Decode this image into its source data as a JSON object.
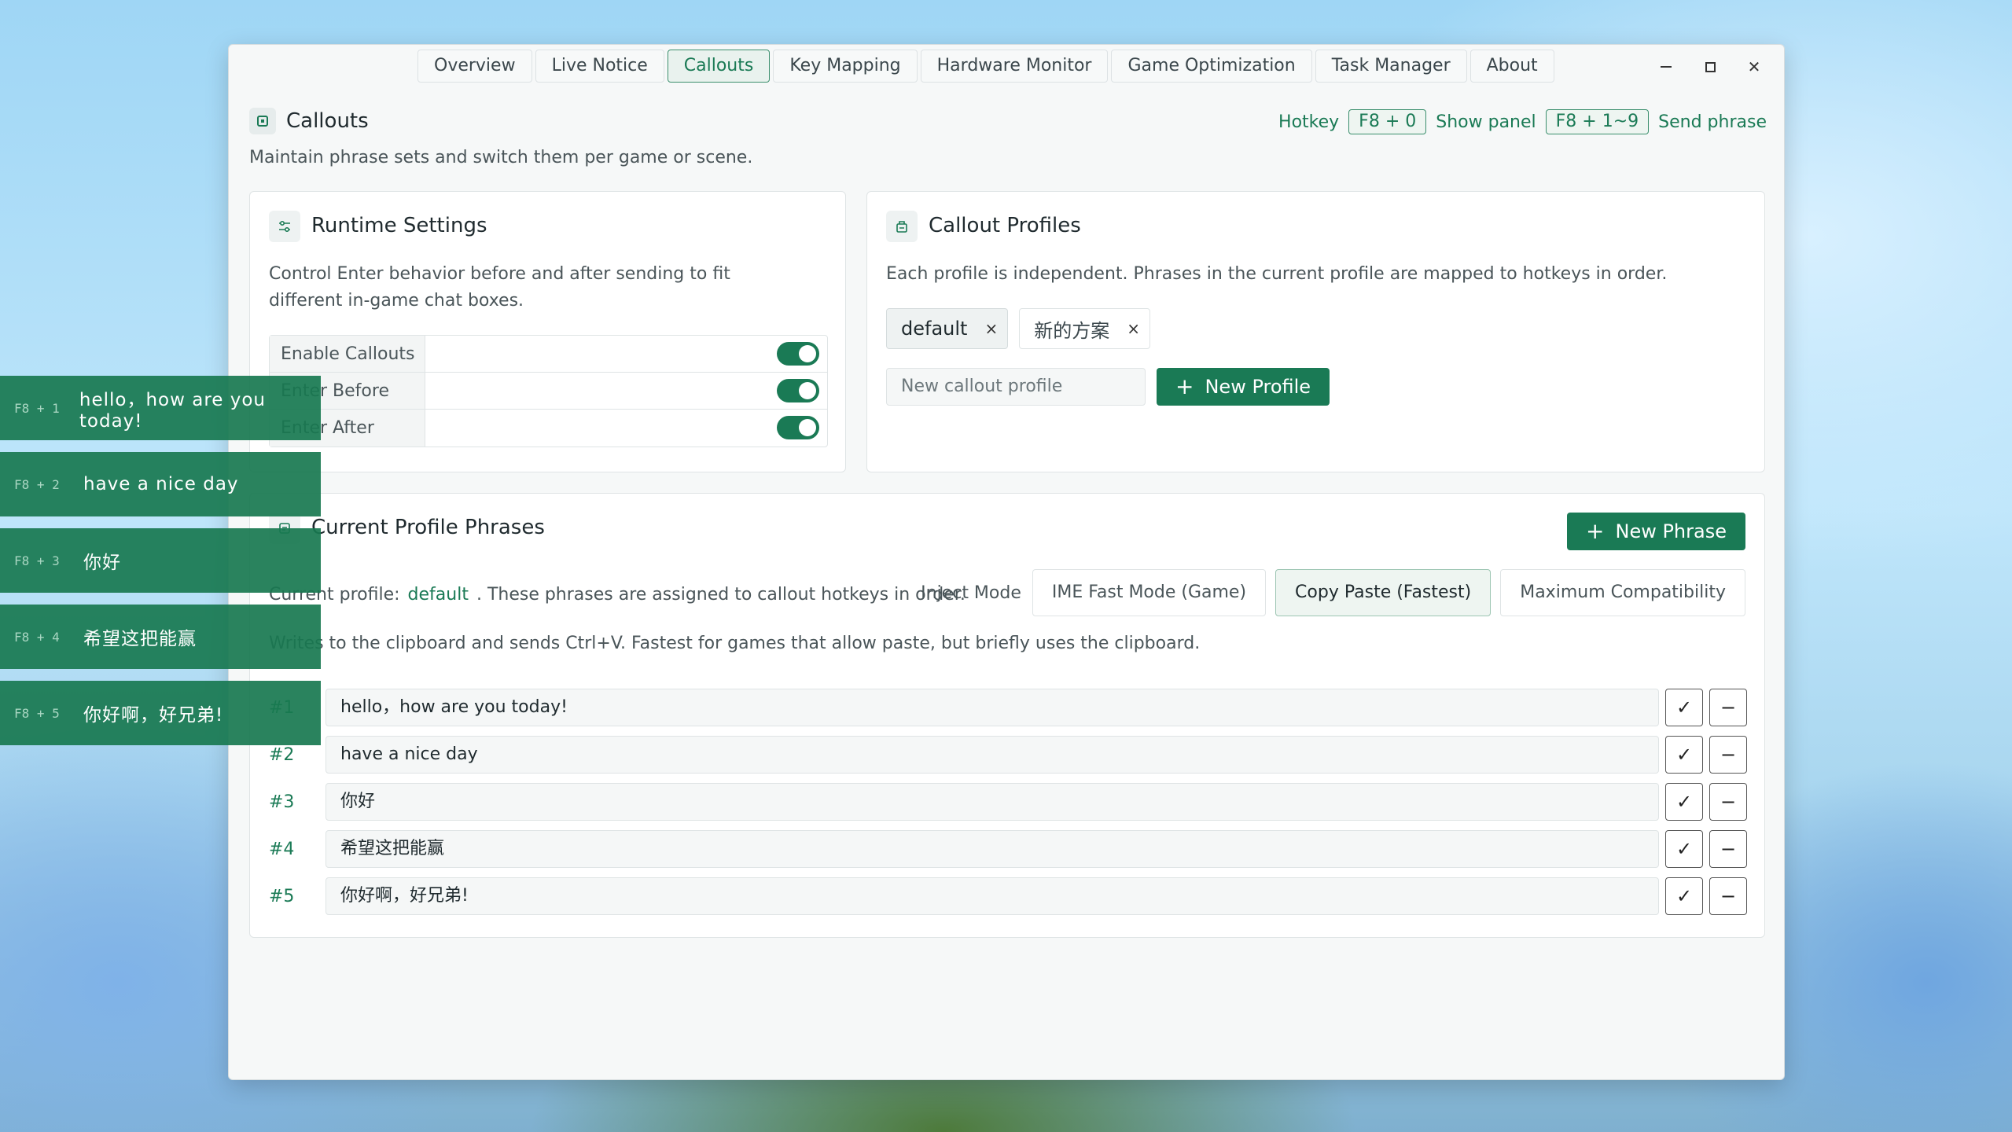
{
  "tabs": [
    {
      "label": "Overview",
      "active": false
    },
    {
      "label": "Live Notice",
      "active": false
    },
    {
      "label": "Callouts",
      "active": true
    },
    {
      "label": "Key Mapping",
      "active": false
    },
    {
      "label": "Hardware Monitor",
      "active": false
    },
    {
      "label": "Game Optimization",
      "active": false
    },
    {
      "label": "Task Manager",
      "active": false
    },
    {
      "label": "About",
      "active": false
    }
  ],
  "window_controls": {
    "close": "✕"
  },
  "header": {
    "title": "Callouts",
    "subtitle": "Maintain phrase sets and switch them per game or scene.",
    "hotkey_label": "Hotkey",
    "hotkey_show": "F8 + 0",
    "show_panel_label": "Show panel",
    "hotkey_send": "F8 + 1~9",
    "send_phrase_label": "Send phrase"
  },
  "runtime": {
    "title": "Runtime Settings",
    "description": "Control Enter behavior before and after sending to fit different in-game chat boxes.",
    "settings": [
      {
        "label": "Enable Callouts",
        "on": true
      },
      {
        "label": "Enter Before",
        "on": true
      },
      {
        "label": "Enter After",
        "on": true
      }
    ]
  },
  "profiles": {
    "title": "Callout Profiles",
    "description": "Each profile is independent. Phrases in the current profile are mapped to hotkeys in order.",
    "items": [
      {
        "name": "default",
        "active": true
      },
      {
        "name": "新的方案",
        "active": false
      }
    ],
    "remove_glyph": "×",
    "new_placeholder": "New callout profile",
    "new_button": "New Profile"
  },
  "phrases": {
    "title": "Current Profile Phrases",
    "new_button": "New Phrase",
    "current_prefix": "Current profile:",
    "current_name": "default",
    "current_suffix": ". These phrases are assigned to callout hotkeys in order.",
    "inject_label": "Inject Mode",
    "modes": [
      {
        "label": "IME Fast Mode (Game)",
        "active": false
      },
      {
        "label": "Copy Paste (Fastest)",
        "active": true
      },
      {
        "label": "Maximum Compatibility",
        "active": false
      }
    ],
    "mode_description": "Writes to the clipboard and sends Ctrl+V. Fastest for games that allow paste, but briefly uses the clipboard.",
    "items": [
      {
        "index": "#1",
        "text": "hello，how are you today!"
      },
      {
        "index": "#2",
        "text": "have a nice day"
      },
      {
        "index": "#3",
        "text": "你好"
      },
      {
        "index": "#4",
        "text": "希望这把能赢"
      },
      {
        "index": "#5",
        "text": "你好啊，好兄弟!"
      }
    ],
    "confirm_glyph": "✓",
    "remove_glyph": "−"
  },
  "overlay": {
    "items": [
      {
        "key": "F8 + 1",
        "text": "hello，how are you today!"
      },
      {
        "key": "F8 + 2",
        "text": "have a nice day"
      },
      {
        "key": "F8 + 3",
        "text": "你好"
      },
      {
        "key": "F8 + 4",
        "text": "希望这把能赢"
      },
      {
        "key": "F8 + 5",
        "text": "你好啊，好兄弟!"
      }
    ]
  },
  "colors": {
    "accent": "#1a7a55",
    "overlay_bg": "#18784f"
  },
  "icons": [
    "callouts-icon",
    "sliders-icon",
    "profile-icon",
    "list-icon",
    "plus-icon",
    "check-icon",
    "minus-icon",
    "close-icon",
    "minimize-icon",
    "maximize-icon"
  ]
}
